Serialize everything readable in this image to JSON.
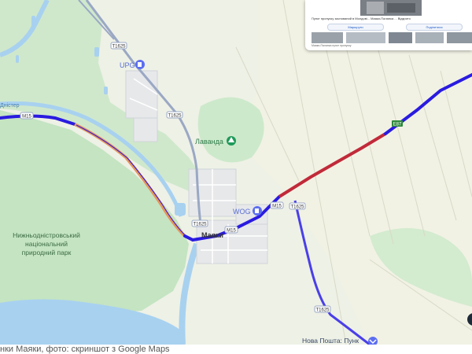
{
  "map": {
    "road_labels": {
      "m15_west": "M15",
      "m15_center": "M15",
      "m15_east": "M15",
      "e87": "E87",
      "t1625_north": "T1625",
      "t1625_mid": "T1625",
      "t1625_center": "T1625",
      "t1625_south": "T1625",
      "t1625_southeast": "T1625"
    },
    "places": {
      "upg": "UPG",
      "lavanda": "Лаванда",
      "wog": "WOG",
      "mayaky": "Маяки",
      "park_line1": "Нижньодністровський",
      "park_line2": "національний",
      "park_line3": "природний парк",
      "river": "Дністер",
      "nova_poshta": "Нова Пошта: Пунк"
    },
    "colors": {
      "land": "#eef1e6",
      "green": "#c9e7c8",
      "water": "#aad3f0",
      "route": "#2a1be0",
      "traffic_red": "#c12a3a",
      "traffic_orange": "#e8955a"
    }
  },
  "inset": {
    "description": "Пункт пропуску заснований в Молдові... Маяки-Паланка ... Відкрито",
    "button_left": "Маршрути",
    "button_right": "Поділитися",
    "footer": "Маяки-Паланка пункт пропуску"
  },
  "caption": "нки Маяки, фото: скриншот з Google Maps"
}
